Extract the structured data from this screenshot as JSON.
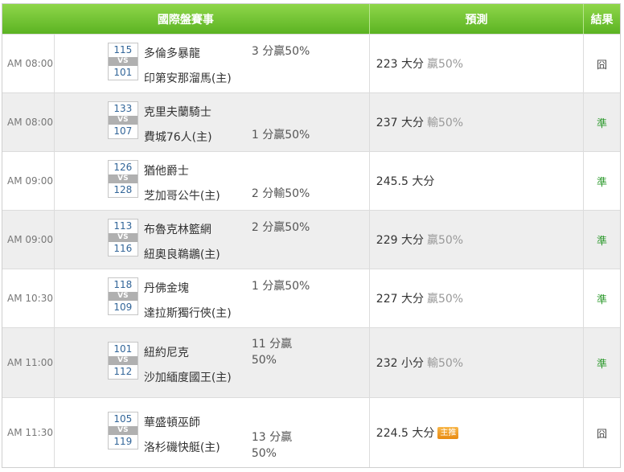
{
  "header": {
    "matches": "國際盤賽事",
    "prediction": "預測",
    "result": "結果"
  },
  "rows": [
    {
      "time": "AM 08:00",
      "score_away": "115",
      "vs": "VS",
      "score_home": "101",
      "team_away": "多倫多暴龍",
      "team_home": "印第安那溜馬(主)",
      "spread": "3 分贏50%",
      "spread_line": "away",
      "prediction": "223 大分",
      "pred_pct": "贏50%",
      "badge": "",
      "result": "囧",
      "result_type": "lose"
    },
    {
      "time": "AM 08:00",
      "score_away": "133",
      "vs": "VS",
      "score_home": "107",
      "team_away": "克里夫蘭騎士",
      "team_home": "費城76人(主)",
      "spread": "1 分贏50%",
      "spread_line": "home",
      "prediction": "237 大分",
      "pred_pct": "輸50%",
      "badge": "",
      "result": "準",
      "result_type": "win"
    },
    {
      "time": "AM 09:00",
      "score_away": "126",
      "vs": "VS",
      "score_home": "128",
      "team_away": "猶他爵士",
      "team_home": "芝加哥公牛(主)",
      "spread": "2 分輸50%",
      "spread_line": "home",
      "prediction": "245.5 大分",
      "pred_pct": "",
      "badge": "",
      "result": "準",
      "result_type": "win"
    },
    {
      "time": "AM 09:00",
      "score_away": "113",
      "vs": "VS",
      "score_home": "116",
      "team_away": "布魯克林籃網",
      "team_home": "紐奧良鵜鶘(主)",
      "spread": "2 分贏50%",
      "spread_line": "away",
      "prediction": "229 大分",
      "pred_pct": "贏50%",
      "badge": "",
      "result": "準",
      "result_type": "win"
    },
    {
      "time": "AM 10:30",
      "score_away": "118",
      "vs": "VS",
      "score_home": "109",
      "team_away": "丹佛金塊",
      "team_home": "達拉斯獨行俠(主)",
      "spread": "1 分贏50%",
      "spread_line": "away",
      "prediction": "227 大分",
      "pred_pct": "贏50%",
      "badge": "",
      "result": "準",
      "result_type": "win"
    },
    {
      "time": "AM 11:00",
      "score_away": "101",
      "vs": "VS",
      "score_home": "112",
      "team_away": "紐約尼克",
      "team_home": "沙加緬度國王(主)",
      "spread": "11 分贏\n50%",
      "spread_line": "wrap",
      "prediction": "232 小分",
      "pred_pct": "輸50%",
      "badge": "",
      "result": "準",
      "result_type": "win"
    },
    {
      "time": "AM 11:30",
      "score_away": "105",
      "vs": "VS",
      "score_home": "119",
      "team_away": "華盛頓巫師",
      "team_home": "洛杉磯快艇(主)",
      "spread": "13 分贏\n50%",
      "spread_line": "wrap-home",
      "prediction": "224.5 大分",
      "pred_pct": "",
      "badge": "主推",
      "result": "囧",
      "result_type": "lose"
    }
  ]
}
